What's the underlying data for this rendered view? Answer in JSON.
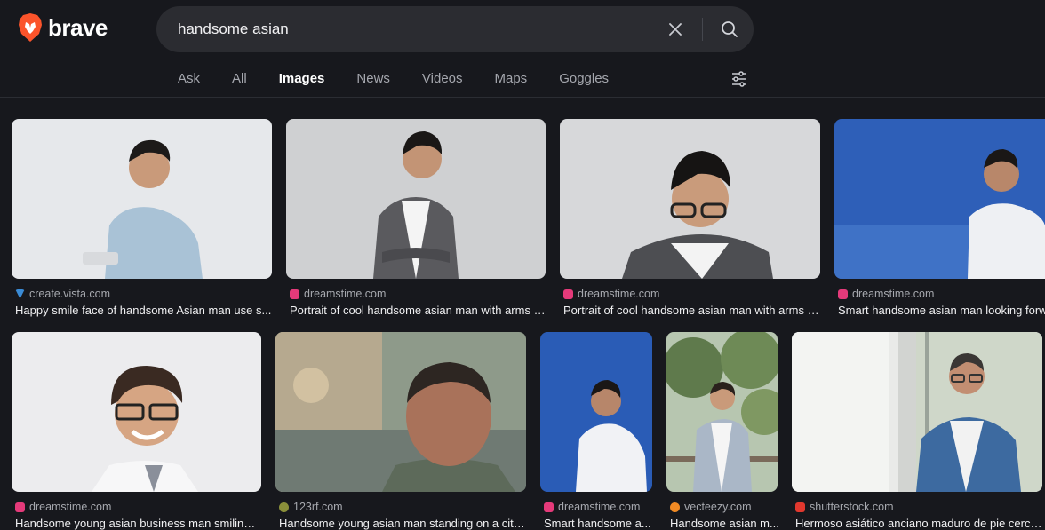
{
  "brand": {
    "name": "brave"
  },
  "search": {
    "query": "handsome asian"
  },
  "tabs": [
    "Ask",
    "All",
    "Images",
    "News",
    "Videos",
    "Maps",
    "Goggles"
  ],
  "active_tab": "Images",
  "colors": {
    "background": "#17181d",
    "brand_orange": "#fb542b",
    "dreamstime_favicon": "#e53a7a",
    "vista_favicon": "#3a8bd6",
    "rf123_favicon": "#8a8f3a",
    "vecteezy_favicon": "#f08a24",
    "shutterstock_favicon": "#e2382e"
  },
  "results": [
    {
      "source": "create.vista.com",
      "caption": "Happy smile face of handsome Asian man use s..."
    },
    {
      "source": "dreamstime.com",
      "caption": "Portrait of cool handsome asian man with arms c..."
    },
    {
      "source": "dreamstime.com",
      "caption": "Portrait of cool handsome asian man with arms c..."
    },
    {
      "source": "dreamstime.com",
      "caption": "Smart handsome asian man looking forwa"
    },
    {
      "source": "dreamstime.com",
      "caption": "Handsome young asian business man smiling. ..."
    },
    {
      "source": "123rf.com",
      "caption": "Handsome young asian man standing on a city..."
    },
    {
      "source": "dreamstime.com",
      "caption": "Smart handsome a..."
    },
    {
      "source": "vecteezy.com",
      "caption": "Handsome asian m..."
    },
    {
      "source": "shutterstock.com",
      "caption": "Hermoso asiático anciano maduro de pie cerca..."
    }
  ]
}
